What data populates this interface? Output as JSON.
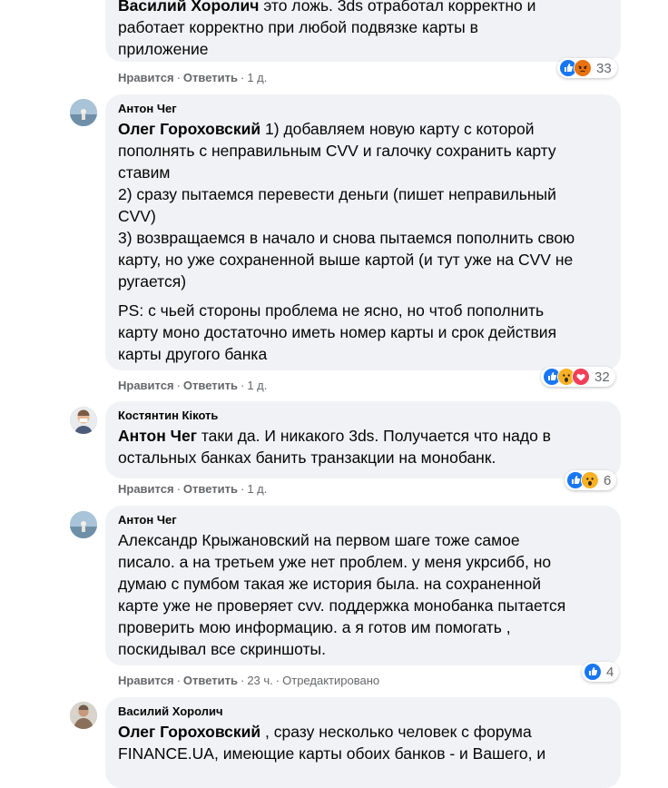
{
  "comments": [
    {
      "author": "",
      "mention": "Василий Хоролич",
      "lines": [
        " это ложь. 3ds отработал корректно и",
        "работает корректно при любой подвязке карты в",
        "приложение"
      ],
      "like_label": "Нравится",
      "reply_label": "Ответить",
      "time": "1 д.",
      "reactions": [
        "like",
        "angry"
      ],
      "reaction_count": "33"
    },
    {
      "author": "Антон Чег",
      "mention": "Олег Гороховский",
      "paragraphs": [
        [
          " 1) добавляем новую карту с которой",
          "пополнять с неправильным CVV и галочку сохранить карту",
          "ставим",
          "2) сразу пытаемся перевести деньги (пишет неправильный",
          "CVV)",
          "3) возвращаемся в начало и снова пытаемся пополнить свою",
          "карту, но уже сохраненной выше картой (и тут уже на CVV не",
          "ругается)"
        ],
        [
          "PS: с чьей стороны проблема не ясно, но чтоб пополнить",
          "карту моно достаточно иметь номер карты и срок действия",
          "карты другого банка"
        ]
      ],
      "like_label": "Нравится",
      "reply_label": "Ответить",
      "time": "1 д.",
      "reactions": [
        "like",
        "wow",
        "love"
      ],
      "reaction_count": "32"
    },
    {
      "author": "Костянтин Кікоть",
      "mention": "Антон Чег",
      "lines": [
        " таки да. И никакого 3ds. Получается что надо в",
        "остальных банках банить транзакции на монобанк."
      ],
      "like_label": "Нравится",
      "reply_label": "Ответить",
      "time": "1 д.",
      "reactions": [
        "like",
        "wow"
      ],
      "reaction_count": "6"
    },
    {
      "author": "Антон Чег",
      "mention": "",
      "lines": [
        "Александр Крыжановский на первом шаге тоже самое",
        "писало. а на третьем уже нет проблем. у меня укрсибб, но",
        "думаю с пумбом такая же история была. на сохраненной",
        "карте уже не проверяет cvv. поддержка монобанка пытается",
        "проверить мою информацию. а я готов им помогать ,",
        "поскидывал все скриншоты."
      ],
      "like_label": "Нравится",
      "reply_label": "Ответить",
      "time": "23 ч.",
      "edited": "Отредактировано",
      "reactions": [
        "like"
      ],
      "reaction_count": "4"
    },
    {
      "author": "Василий Хоролич",
      "mention": "Олег Гороховский",
      "lines": [
        " , сразу несколько человек с форума",
        "FINANCE.UA, имеющие карты обоих банков - и Вашего, и"
      ]
    }
  ],
  "colors": {
    "bubble": "#f0f2f5",
    "like_blue": "#1877f2",
    "angry_orange": "#e9710f",
    "wow_yellow": "#f7b125",
    "love_red": "#f33e58",
    "meta_grey": "#65676b"
  }
}
